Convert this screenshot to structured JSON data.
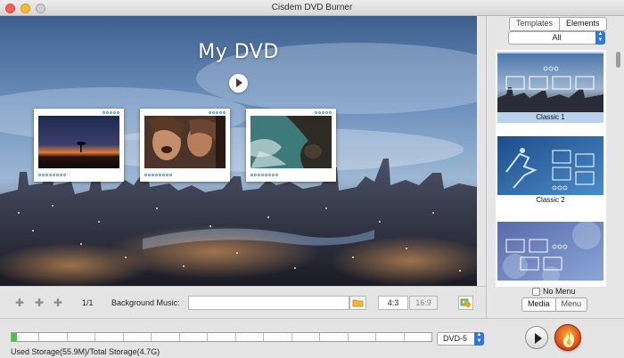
{
  "window": {
    "title": "Cisdem DVD Burner"
  },
  "colors": {
    "accent": "#2f77d9",
    "storage_fill": "#47c743",
    "selected_tile": "#b9d3ef"
  },
  "preview": {
    "menu_title": "My DVD",
    "play_icon": "play-icon",
    "thumbnails": [
      {
        "name": "sunset-tree-clip"
      },
      {
        "name": "laughing-people-clip"
      },
      {
        "name": "coast-aerial-clip"
      }
    ]
  },
  "toolbar": {
    "add_icon": "plus-icon",
    "prev_icon": "arrow-left-icon",
    "next_icon": "arrow-right-icon",
    "page_indicator": "1/1",
    "background_music_label": "Background Music:",
    "background_music_value": "",
    "ratio_options": [
      "4:3",
      "16:9"
    ],
    "ratio_selected": "4:3"
  },
  "right_panel": {
    "tabs": [
      "Templates",
      "Elements"
    ],
    "active_tab": "Elements",
    "filter_value": "All",
    "templates": [
      {
        "label": "Classic 1",
        "selected": true
      },
      {
        "label": "Classic 2",
        "selected": false
      },
      {
        "label": "",
        "selected": false
      }
    ],
    "no_menu_label": "No Menu",
    "no_menu_checked": false,
    "bottom_tabs": [
      "Media",
      "Menu"
    ],
    "active_bottom_tab": "Media"
  },
  "status": {
    "disc_type": "DVD-5",
    "storage_text": "Used Storage(55.9M)/Total Storage(4.7G)",
    "used_fraction": 0.012
  }
}
